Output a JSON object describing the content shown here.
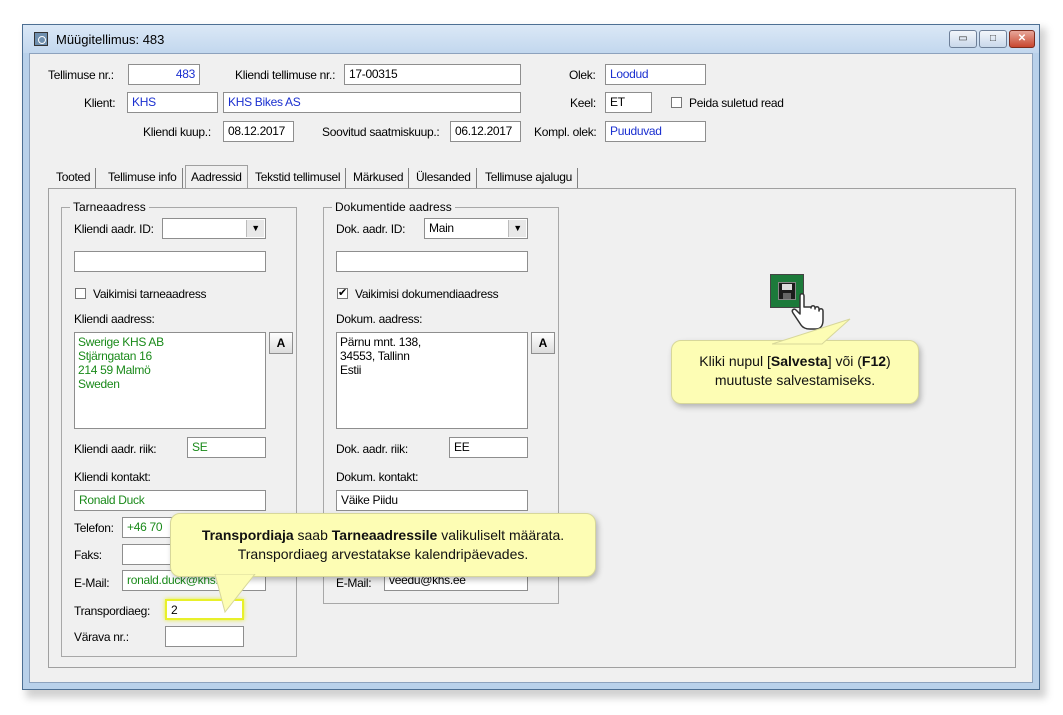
{
  "window": {
    "title": "Müügitellimus: 483",
    "minimize_glyph": "▭",
    "maximize_glyph": "□",
    "close_glyph": "✕"
  },
  "header": {
    "order_no_label": "Tellimuse nr.:",
    "order_no_value": "483",
    "client_order_no_label": "Kliendi tellimuse nr.:",
    "client_order_no_value": "17-00315",
    "status_label": "Olek:",
    "status_value": "Loodud",
    "client_label": "Klient:",
    "client_code": "KHS",
    "client_name": "KHS Bikes AS",
    "language_label": "Keel:",
    "language_value": "ET",
    "hide_closed_label": "Peida suletud read",
    "client_date_label": "Kliendi kuup.:",
    "client_date_value": "08.12.2017",
    "desired_delivery_label": "Soovitud saatmiskuup.:",
    "desired_delivery_value": "06.12.2017",
    "kompl_label": "Kompl. olek:",
    "kompl_value": "Puuduvad"
  },
  "tabs": [
    {
      "label": "Tooted"
    },
    {
      "label": "Tellimuse info"
    },
    {
      "label": "Aadressid"
    },
    {
      "label": "Tekstid tellimusel"
    },
    {
      "label": "Märkused"
    },
    {
      "label": "Ülesanded"
    },
    {
      "label": "Tellimuse ajalugu"
    }
  ],
  "delivery": {
    "group_title": "Tarneaadress",
    "addr_id_label": "Kliendi aadr. ID:",
    "addr_id_value": "",
    "default_label": "Vaikimisi tarneaadress",
    "address_label": "Kliendi aadress:",
    "address_lines": [
      "Swerige KHS AB",
      "Stjärngatan 16",
      "214 59 Malmö",
      "Sweden"
    ],
    "a_button": "A",
    "country_label": "Kliendi aadr. riik:",
    "country_value": "SE",
    "contact_label": "Kliendi kontakt:",
    "contact_value": "Ronald Duck",
    "phone_label": "Telefon:",
    "phone_value": "+46 70",
    "fax_label": "Faks:",
    "fax_value": "",
    "email_label": "E-Mail:",
    "email_value": "ronald.duck@khs.se",
    "transport_label": "Transpordiaeg:",
    "transport_value": "2",
    "gate_label": "Värava nr.:",
    "gate_value": ""
  },
  "documents": {
    "group_title": "Dokumentide aadress",
    "addr_id_label": "Dok. aadr. ID:",
    "addr_id_value": "Main",
    "default_label": "Vaikimisi dokumendiaadress",
    "default_checked": "✔",
    "address_label": "Dokum. aadress:",
    "address_lines": [
      "Pärnu mnt. 138,",
      "34553, Tallinn",
      "Estii"
    ],
    "a_button": "A",
    "country_label": "Dok. aadr. riik:",
    "country_value": "EE",
    "contact_label": "Dokum. kontakt:",
    "contact_value": "Väike Piidu",
    "email_label": "E-Mail:",
    "email_value": "veedu@khs.ee"
  },
  "callouts": {
    "save_hint_1": "Kliki nupul [",
    "save_hint_bold1": "Salvesta",
    "save_hint_2": "] või (",
    "save_hint_bold2": "F12",
    "save_hint_3": ")",
    "save_hint_line2": "muutuste salvestamiseks.",
    "transport_bold1": "Transpordiaja",
    "transport_mid": " saab ",
    "transport_bold2": "Tarneaadressile",
    "transport_end": " valikuliselt määrata.",
    "transport_line2": "Transpordiaeg arvestatakse kalendripäevades."
  }
}
